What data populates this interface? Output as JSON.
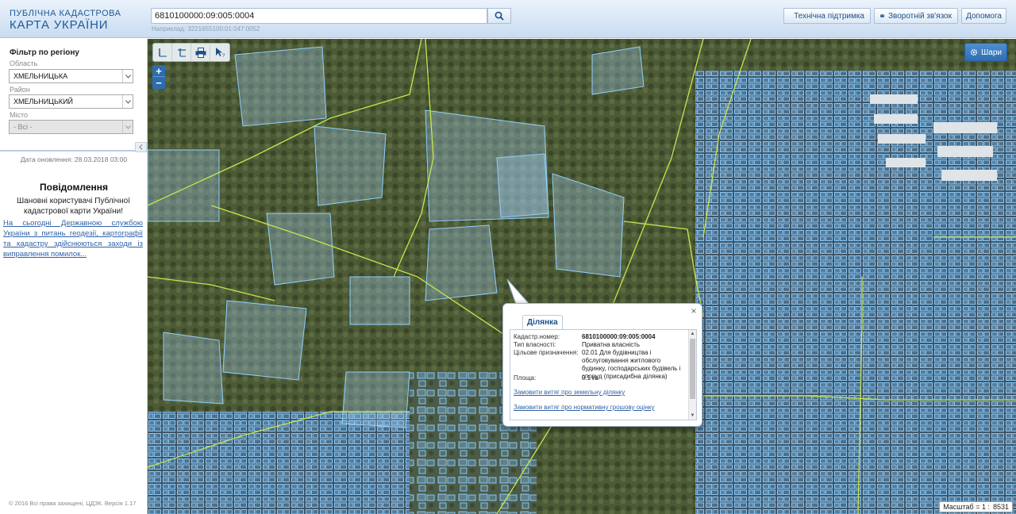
{
  "header": {
    "logo_line1": "ПУБЛІЧНА КАДАСТРОВА",
    "logo_line2": "КАРТА УКРАЇНИ",
    "search_value": "6810100000:09:005:0004",
    "search_hint": "Наприклад: 3221655100:01:047:0052",
    "support_label": "Технічна підтримка",
    "feedback_label": "Зворотній зв'язок",
    "help_label": "Допомога"
  },
  "sidebar": {
    "filter_title": "Фільтр по регіону",
    "region_label": "Область",
    "region_value": "ХМЕЛЬНИЦЬКА",
    "district_label": "Район",
    "district_value": "ХМЕЛЬНИЦЬКИЙ",
    "city_label": "Місто",
    "city_value": "- Всі -",
    "updated": "Дата оновлення: 28.03.2018 03:00",
    "notice_title": "Повідомлення",
    "notice_body": "Шановні користувачі Публічної кадастрової карти України!",
    "notice_link": "На сьогодні Державною службою України з питань геодезії, картографії та кадастру здійснюються заходи із виправлення помилок...",
    "copyright": "© 2016 Всі права захищені, ЦДЗК. Версія 1.17"
  },
  "map": {
    "layers_label": "Шари",
    "scale_label": "Масштаб = 1 :",
    "scale_value": "8531",
    "icons": {
      "measure_distance": "ruler-icon",
      "measure_area": "area-measure-icon",
      "print": "printer-icon",
      "info": "pointer-info-icon",
      "layers": "gear-icon"
    }
  },
  "popup": {
    "tab": "Ділянка",
    "cadastral_label": "Кадастр.номер:",
    "cadastral_value": "6810100000:09:005:0004",
    "ownership_label": "Тип власності:",
    "ownership_value": "Приватна власність",
    "purpose_label": "Цільове призначення:",
    "purpose_value": "02.01 Для будівництва і обслуговування житлового будинку, господарських будівель і споруд (присадибна ділянка)",
    "area_label": "Площа:",
    "area_value": "0.1 га",
    "link1": "Замовити витяг про земельну ділянку",
    "link2": "Замовити витяг про нормативну грошову оцінку"
  },
  "colors": {
    "accent": "#2d6cb0",
    "parcel_stroke": "#7fc4ff",
    "boundary": "#c8e64a",
    "link": "#2f63a8"
  }
}
